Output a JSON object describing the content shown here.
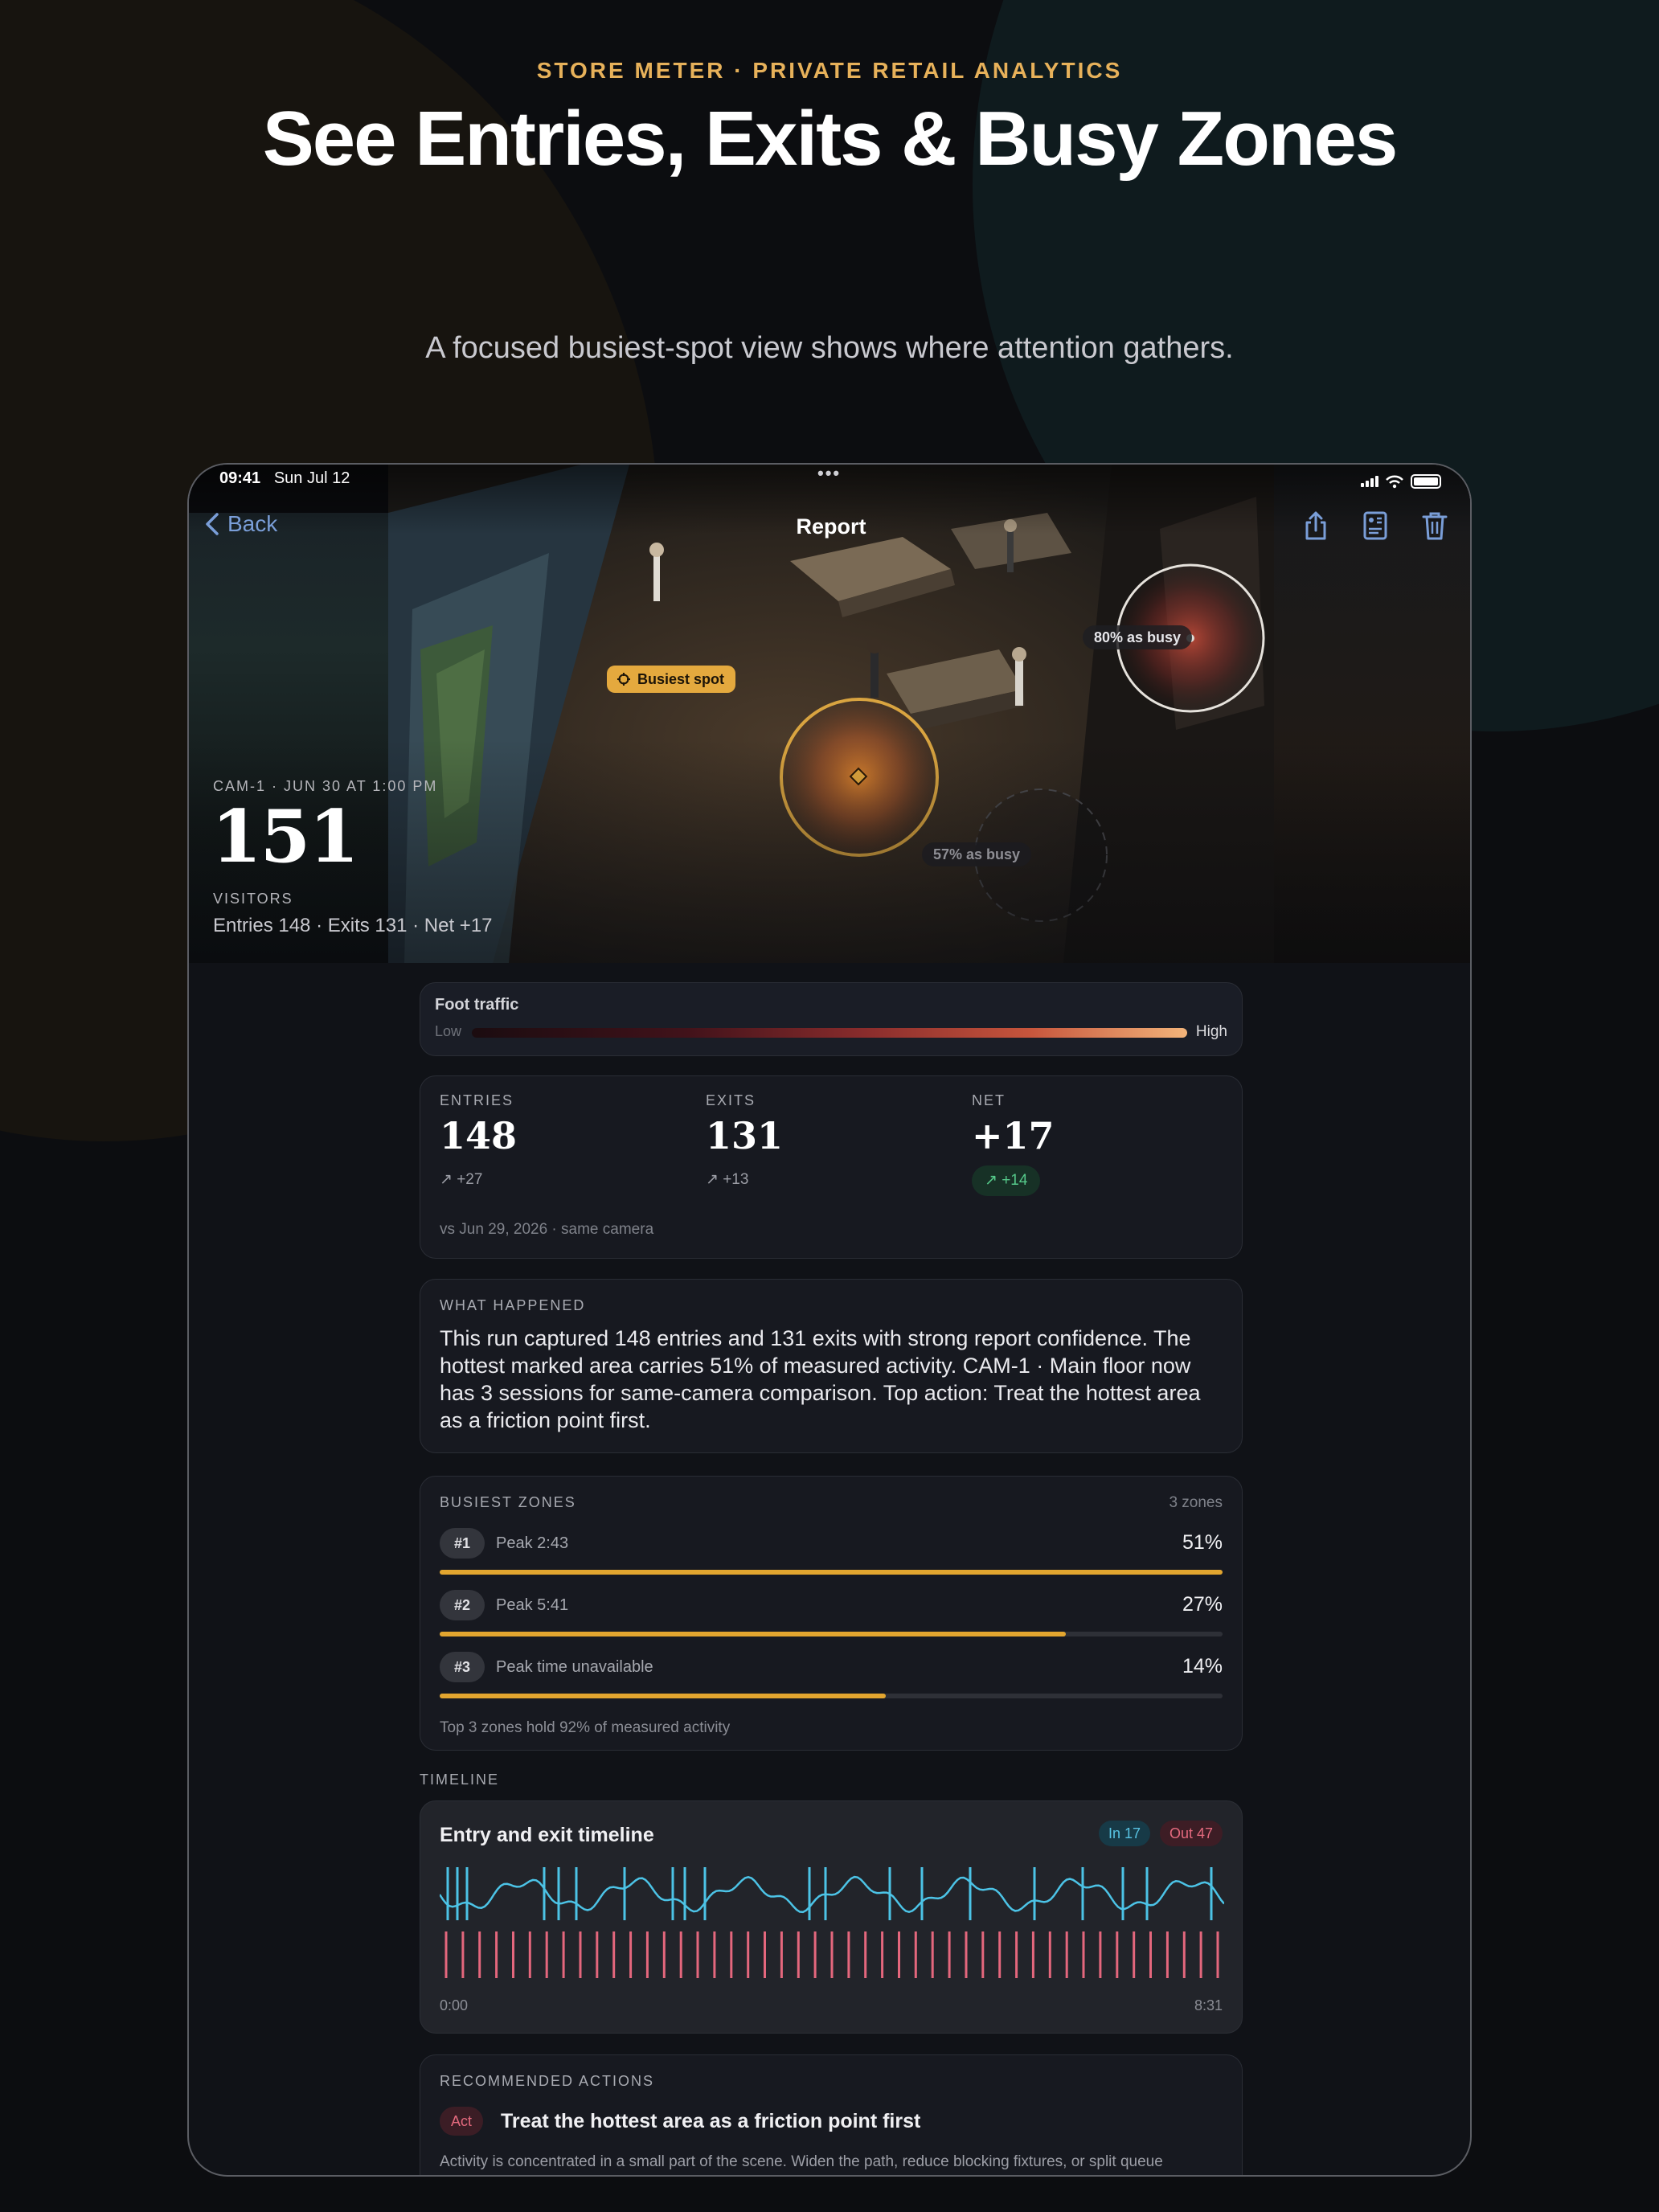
{
  "header": {
    "eyebrow": "STORE METER · PRIVATE RETAIL ANALYTICS",
    "headline": "See Entries, Exits & Busy Zones",
    "subtitle": "A focused busiest-spot view shows where attention gathers."
  },
  "status_bar": {
    "time": "09:41",
    "date": "Sun Jul 12"
  },
  "nav": {
    "back_label": "Back",
    "title": "Report"
  },
  "hero": {
    "camera_label": "CAM-1 · JUN 30 AT 1:00 PM",
    "visitors": "151",
    "visitors_label": "VISITORS",
    "summary": "Entries 148 · Exits 131 · Net +17",
    "busiest_label": "Busiest spot",
    "zone_labels": [
      "80% as busy",
      "57% as busy"
    ]
  },
  "foot_traffic": {
    "title": "Foot traffic",
    "low": "Low",
    "high": "High"
  },
  "metrics": {
    "entries": {
      "label": "ENTRIES",
      "value": "148",
      "delta": "+27"
    },
    "exits": {
      "label": "EXITS",
      "value": "131",
      "delta": "+13"
    },
    "net": {
      "label": "NET",
      "value": "+17",
      "delta": "+14"
    },
    "comparison": "vs Jun 29, 2026 · same camera"
  },
  "what_happened": {
    "label": "WHAT HAPPENED",
    "text": "This run captured 148 entries and 131 exits with strong report confidence. The hottest marked area carries 51% of measured activity. CAM-1 · Main floor now has 3 sessions for same-camera comparison. Top action: Treat the hottest area as a friction point first."
  },
  "busiest_zones": {
    "label": "BUSIEST ZONES",
    "count": "3 zones",
    "zones": [
      {
        "rank": "#1",
        "peak": "Peak 2:43",
        "percent": "51%",
        "fill": 1.0
      },
      {
        "rank": "#2",
        "peak": "Peak 5:41",
        "percent": "27%",
        "fill": 0.8
      },
      {
        "rank": "#3",
        "peak": "Peak time unavailable",
        "percent": "14%",
        "fill": 0.57
      }
    ],
    "footer": "Top 3 zones hold 92% of measured activity"
  },
  "timeline": {
    "section_label": "TIMELINE",
    "title": "Entry and exit timeline",
    "in_label": "In 17",
    "out_label": "Out 47",
    "start": "0:00",
    "end": "8:31"
  },
  "recommended_actions": {
    "label": "RECOMMENDED ACTIONS",
    "badge": "Act",
    "title": "Treat the hottest area as a friction point first",
    "description": "Activity is concentrated in a small part of the scene. Widen the path, reduce blocking fixtures, or split queue attention before adding more visual load there."
  },
  "colors": {
    "accent_gold": "#e2a52f",
    "entries_cyan": "#4cc3e6",
    "exits_pink": "#e4677d",
    "link_blue": "#7a9ed8",
    "positive_green": "#55c98a"
  }
}
